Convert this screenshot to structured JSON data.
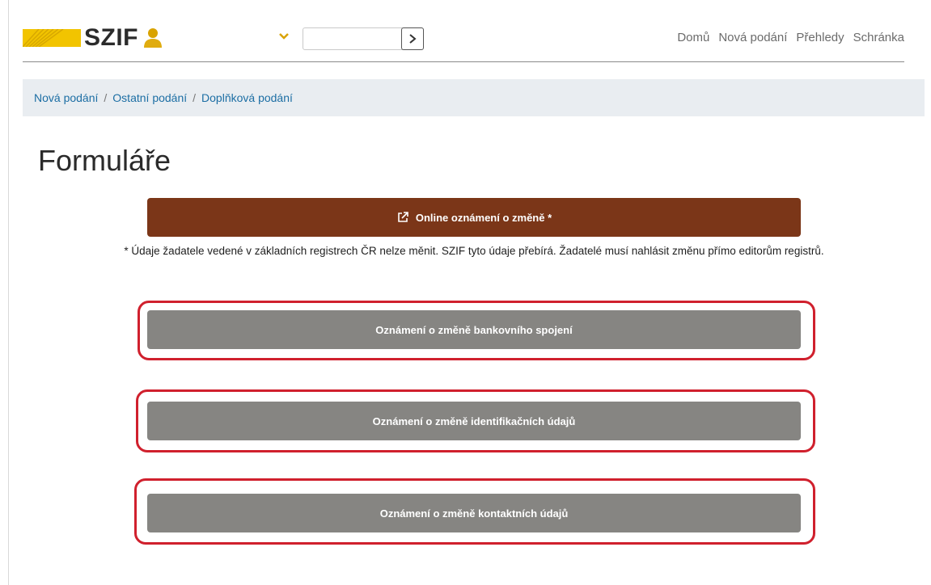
{
  "header": {
    "logo_text": "SZIF",
    "user_select_value": "",
    "search": {
      "value": "",
      "placeholder": ""
    },
    "nav": [
      "Domů",
      "Nová podání",
      "Přehledy",
      "Schránka"
    ]
  },
  "breadcrumb": [
    "Nová podání",
    "Ostatní podání",
    "Doplňková podání"
  ],
  "page_title": "Formuláře",
  "online_button_label": "Online oznámení o změně *",
  "note": "* Údaje žadatele vedené v základních registrech ČR nelze měnit. SZIF tyto údaje přebírá. Žadatelé musí nahlásit změnu přímo editorům registrů.",
  "form_buttons": [
    "Oznámení o změně bankovního spojení",
    "Oznámení o změně identifikačních údajů",
    "Oznámení o změně kontaktních údajů"
  ],
  "colors": {
    "logo_yellow": "#f2c400",
    "primary_button": "#7b3618",
    "gray_button": "#868582",
    "highlight": "#d0202d",
    "breadcrumb_bg": "#e9edf1",
    "link": "#1c6ea4"
  },
  "icons": {
    "logo": "szif-logo-stripes",
    "user": "user-icon",
    "dropdown": "chevron-down-icon",
    "go": "chevron-right-icon",
    "online": "external-link-icon"
  }
}
